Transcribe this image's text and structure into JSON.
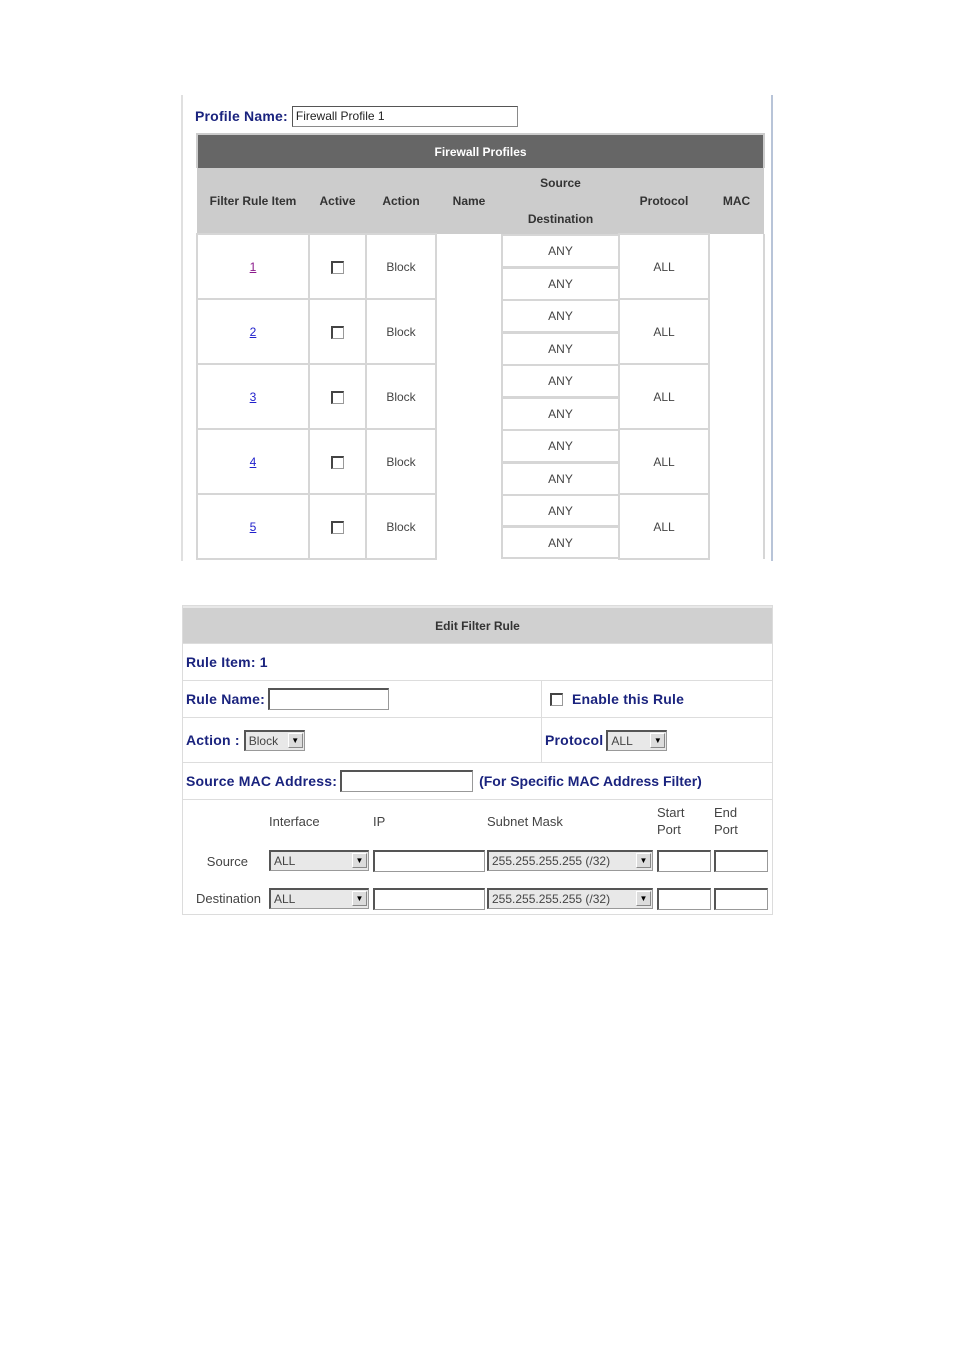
{
  "profile": {
    "label": "Profile Name:",
    "value": "Firewall Profile 1"
  },
  "firewall_table": {
    "title": "Firewall Profiles",
    "headers": {
      "filter_rule_item": "Filter Rule Item",
      "active": "Active",
      "action": "Action",
      "name": "Name",
      "source": "Source",
      "destination": "Destination",
      "protocol": "Protocol",
      "mac": "MAC"
    },
    "rows": [
      {
        "item": "1",
        "visited": true,
        "active": false,
        "action": "Block",
        "name": "",
        "source": "ANY",
        "destination": "ANY",
        "protocol": "ALL",
        "mac": ""
      },
      {
        "item": "2",
        "visited": false,
        "active": false,
        "action": "Block",
        "name": "",
        "source": "ANY",
        "destination": "ANY",
        "protocol": "ALL",
        "mac": ""
      },
      {
        "item": "3",
        "visited": false,
        "active": false,
        "action": "Block",
        "name": "",
        "source": "ANY",
        "destination": "ANY",
        "protocol": "ALL",
        "mac": ""
      },
      {
        "item": "4",
        "visited": false,
        "active": false,
        "action": "Block",
        "name": "",
        "source": "ANY",
        "destination": "ANY",
        "protocol": "ALL",
        "mac": ""
      },
      {
        "item": "5",
        "visited": false,
        "active": false,
        "action": "Block",
        "name": "",
        "source": "ANY",
        "destination": "ANY",
        "protocol": "ALL",
        "mac": ""
      }
    ]
  },
  "edit_rule": {
    "title": "Edit Filter Rule",
    "rule_item": "Rule Item: 1",
    "rule_name_label": "Rule Name:",
    "rule_name_value": "",
    "enable_label": "Enable this Rule",
    "enable_checked": false,
    "action_label": "Action :",
    "action_value": "Block",
    "protocol_label": "Protocol",
    "protocol_value": "ALL",
    "mac_label": "Source MAC Address:",
    "mac_value": "",
    "mac_note": "(For Specific MAC Address Filter)",
    "columns": {
      "interface": "Interface",
      "ip": "IP",
      "subnet_mask": "Subnet Mask",
      "start_port_1": "Start",
      "start_port_2": "Port",
      "end_port_1": "End",
      "end_port_2": "Port"
    },
    "source": {
      "label": "Source",
      "interface": "ALL",
      "ip": "",
      "subnet_mask": "255.255.255.255 (/32)",
      "start_port": "",
      "end_port": ""
    },
    "destination": {
      "label": "Destination",
      "interface": "ALL",
      "ip": "",
      "subnet_mask": "255.255.255.255 (/32)",
      "start_port": "",
      "end_port": ""
    }
  },
  "icons": {
    "dropdown_arrow": "▼"
  }
}
